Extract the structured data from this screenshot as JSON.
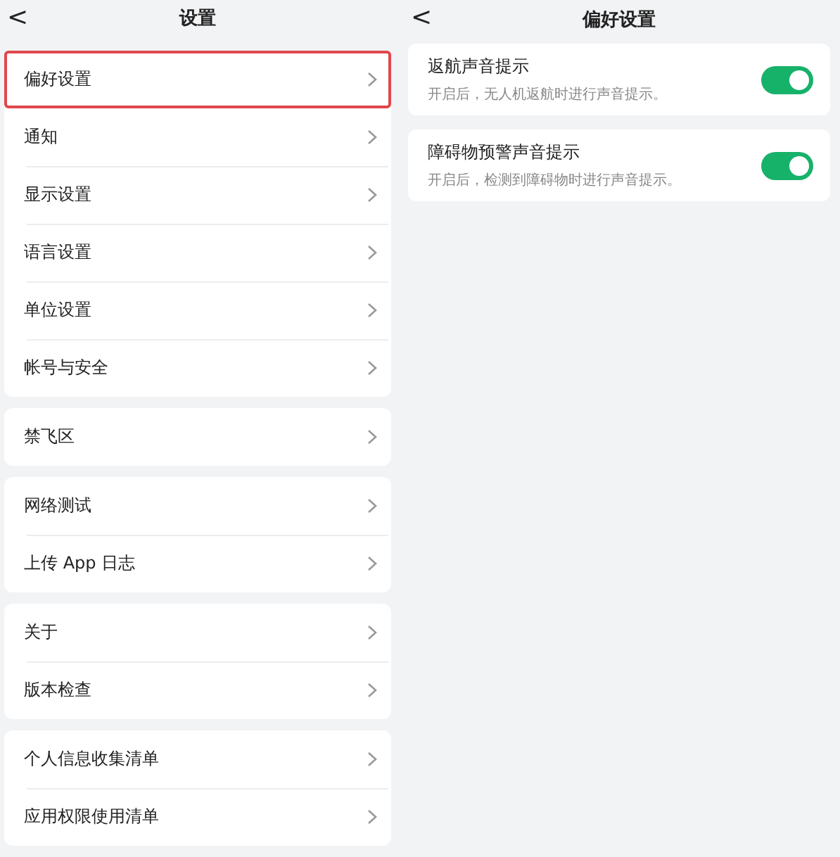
{
  "settings_screen": {
    "back": "<",
    "title": "设置",
    "groups": [
      {
        "items": [
          {
            "label": "偏好设置",
            "highlighted": true
          },
          {
            "label": "通知",
            "highlighted": false
          },
          {
            "label": "显示设置",
            "highlighted": false
          },
          {
            "label": "语言设置",
            "highlighted": false
          },
          {
            "label": "单位设置",
            "highlighted": false
          },
          {
            "label": "帐号与安全",
            "highlighted": false
          }
        ]
      },
      {
        "items": [
          {
            "label": "禁飞区",
            "highlighted": false
          }
        ]
      },
      {
        "items": [
          {
            "label": "网络测试",
            "highlighted": false
          },
          {
            "label": "上传 App 日志",
            "highlighted": false
          }
        ]
      },
      {
        "items": [
          {
            "label": "关于",
            "highlighted": false
          },
          {
            "label": "版本检查",
            "highlighted": false
          }
        ]
      },
      {
        "items": [
          {
            "label": "个人信息收集清单",
            "highlighted": false
          },
          {
            "label": "应用权限使用清单",
            "highlighted": false
          }
        ]
      }
    ]
  },
  "preferences_screen": {
    "back": "<",
    "title": "偏好设置",
    "options": [
      {
        "label": "返航声音提示",
        "description": "开启后，无人机返航时进行声音提示。",
        "on": true
      },
      {
        "label": "障碍物预警声音提示",
        "description": "开启后，检测到障碍物时进行声音提示。",
        "on": true
      }
    ]
  }
}
